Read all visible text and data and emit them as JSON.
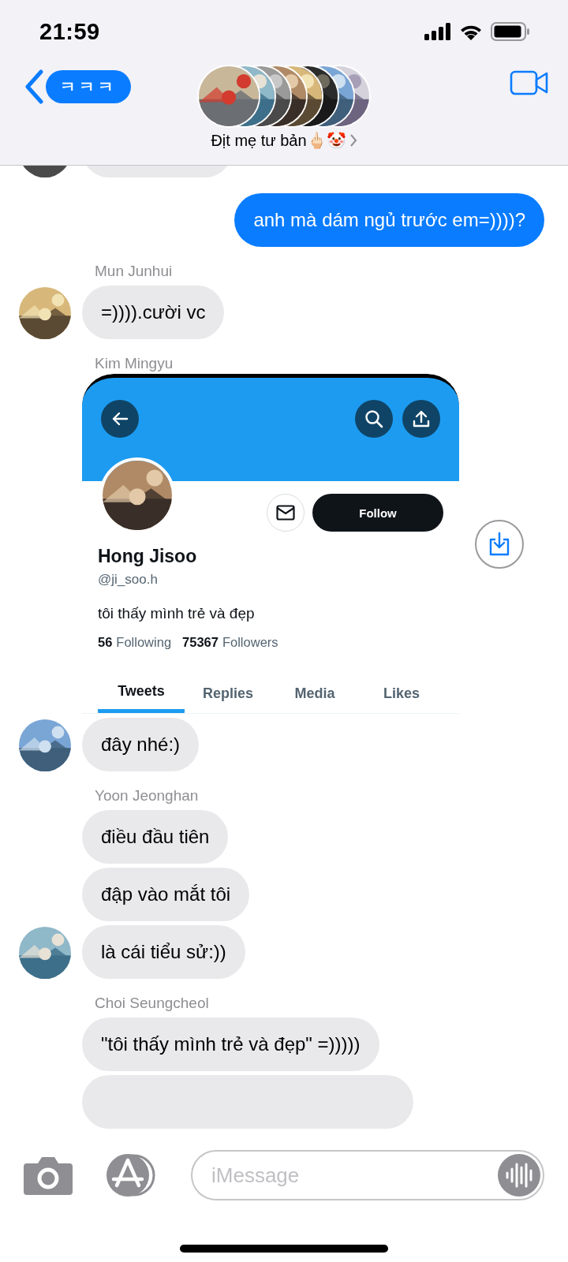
{
  "status_bar": {
    "time": "21:59"
  },
  "header": {
    "back_label": "ㅋㅋㅋ",
    "group_name": "Địt mẹ tư bản🖕🏻🤡"
  },
  "messages": [
    {
      "kind": "incoming",
      "avatar": true
    },
    {
      "kind": "outgoing",
      "text": "anh mà dám ngủ trước em=))))?"
    },
    {
      "kind": "incoming",
      "sender": "Mun Junhui",
      "text": "=)))).cười vc",
      "avatar": true
    },
    {
      "kind": "screenshot",
      "sender": "Kim Mingyu",
      "profile": {
        "name": "Hong Jisoo",
        "handle": "@ji_soo.h",
        "bio": "tôi thấy mình trẻ và đẹp",
        "follow_label": "Follow",
        "stats": [
          {
            "count": "56",
            "label": "Following"
          },
          {
            "count": "75367",
            "label": "Followers"
          }
        ],
        "tabs": [
          {
            "label": "Tweets",
            "selected": true
          },
          {
            "label": "Replies",
            "selected": false
          },
          {
            "label": "Media",
            "selected": false
          },
          {
            "label": "Likes",
            "selected": false
          }
        ]
      }
    },
    {
      "kind": "incoming",
      "text": "đây nhé:)",
      "avatar": true
    },
    {
      "kind": "incoming",
      "sender": "Yoon Jeonghan",
      "text": "điều đầu tiên",
      "avatar": false
    },
    {
      "kind": "incoming",
      "text": "đập vào mắt tôi",
      "avatar": false
    },
    {
      "kind": "incoming",
      "text": "là cái tiểu sử:))",
      "avatar": true
    },
    {
      "kind": "incoming",
      "sender": "Choi Seungcheol",
      "text": "\"tôi thấy mình trẻ và đẹp\" =)))))",
      "avatar": false
    },
    {
      "kind": "incoming",
      "avatar": false
    }
  ],
  "compose": {
    "placeholder": "iMessage"
  }
}
